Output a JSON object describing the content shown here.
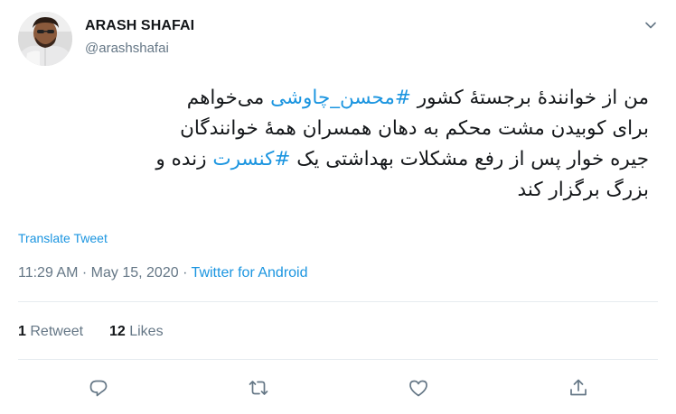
{
  "user": {
    "display_name": "ARASH SHAFAI",
    "handle": "@arashshafai"
  },
  "tweet": {
    "lines": [
      [
        {
          "text": "من از خوانندهٔ برجستهٔ کشور ",
          "type": "text"
        },
        {
          "text": "#محسن_چاوشی",
          "type": "hashtag"
        },
        {
          "text": " می‌خواهم",
          "type": "text"
        }
      ],
      [
        {
          "text": "برای کوبیدن مشت محکم به دهان همسران همهٔ خوانندگان",
          "type": "text"
        }
      ],
      [
        {
          "text": "جیره خوار پس از رفع مشکلات بهداشتی یک ",
          "type": "text"
        },
        {
          "text": "#کنسرت",
          "type": "hashtag"
        },
        {
          "text": " زنده و",
          "type": "text"
        }
      ],
      [
        {
          "text": "بزرگ برگزار کند",
          "type": "text"
        }
      ]
    ],
    "translate_label": "Translate Tweet",
    "time": "11:29 AM",
    "date": "May 15, 2020",
    "separator": "·",
    "source": "Twitter for Android"
  },
  "stats": {
    "retweet_count": "1",
    "retweet_label": "Retweet",
    "like_count": "12",
    "like_label": "Likes"
  },
  "icons": {
    "caret": "chevron-down-icon",
    "reply": "reply-icon",
    "retweet": "retweet-icon",
    "like": "heart-icon",
    "share": "share-icon"
  },
  "colors": {
    "link": "#1b95e0",
    "secondary_text": "#657786",
    "primary_text": "#14171a",
    "divider": "#e6ecf0"
  }
}
